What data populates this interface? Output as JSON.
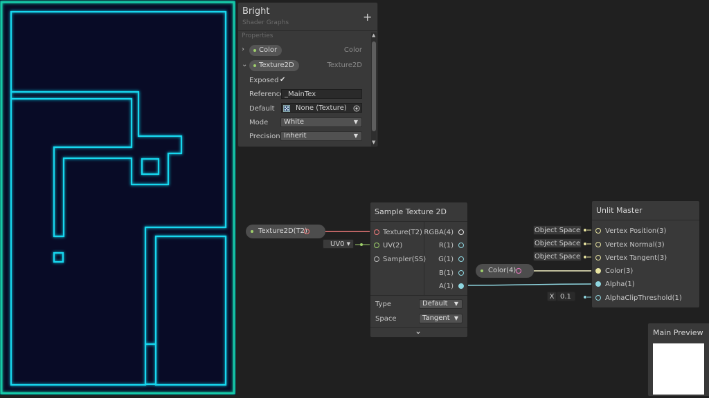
{
  "blackboard": {
    "title": "Bright",
    "subtitle": "Shader Graphs",
    "plus": "+",
    "properties_label": "Properties",
    "props": [
      {
        "name": "Color",
        "type": "Color",
        "chevron": "›"
      },
      {
        "name": "Texture2D",
        "type": "Texture2D",
        "chevron": "⌄"
      }
    ],
    "exposed_label": "Exposed",
    "exposed_check": "✔",
    "reference_label": "Reference",
    "reference_value": "_MainTex",
    "default_label": "Default",
    "default_value": "None (Texture)",
    "mode_label": "Mode",
    "mode_value": "White",
    "precision_label": "Precision",
    "precision_value": "Inherit"
  },
  "nodes": {
    "texture_prop": {
      "label": "Texture2D(T2)"
    },
    "uv_dropdown": "UV0",
    "sample": {
      "title": "Sample Texture 2D",
      "inputs": [
        "Texture(T2)",
        "UV(2)",
        "Sampler(SS)"
      ],
      "outputs": [
        "RGBA(4)",
        "R(1)",
        "G(1)",
        "B(1)",
        "A(1)"
      ],
      "type_label": "Type",
      "type_value": "Default",
      "space_label": "Space",
      "space_value": "Tangent",
      "expand": "⌄"
    },
    "color_prop": {
      "label": "Color(4)"
    },
    "unlit": {
      "title": "Unlit Master",
      "inputs": [
        "Vertex Position(3)",
        "Vertex Normal(3)",
        "Vertex Tangent(3)",
        "Color(3)",
        "Alpha(1)",
        "AlphaClipThreshold(1)"
      ],
      "space_fields": [
        "Object Space",
        "Object Space",
        "Object Space"
      ],
      "x_label": "X",
      "x_value": "0.1"
    }
  },
  "preview": {
    "title": "Main Preview"
  },
  "colors": {
    "neon": "#12d8f0",
    "texture_wire": "#f07b7b",
    "color_wire": "#f5f3c6",
    "alpha_wire": "#8fd6e0"
  }
}
